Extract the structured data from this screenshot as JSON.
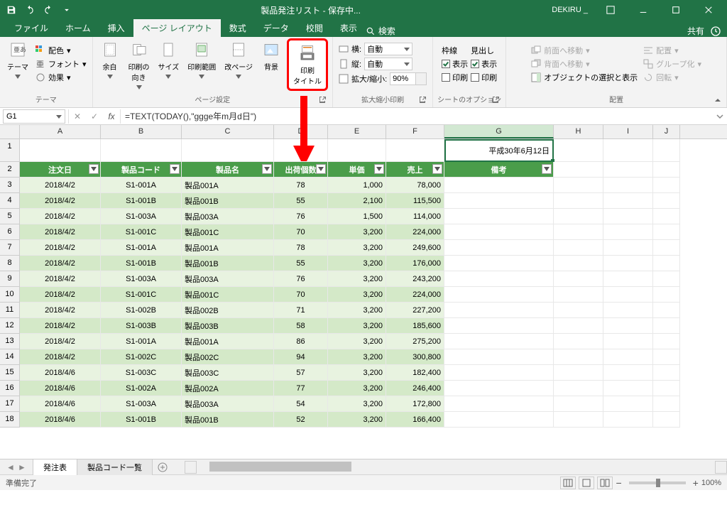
{
  "title": "製品発注リスト - 保存中...",
  "account": "DEKIRU _",
  "file_menu": "ファイル",
  "tabs": [
    "ホーム",
    "挿入",
    "ページ レイアウト",
    "数式",
    "データ",
    "校閲",
    "表示"
  ],
  "search": "検索",
  "share": "共有",
  "ribbon": {
    "themes": {
      "label": "テーマ",
      "theme": "テーマ",
      "colors": "配色",
      "fonts": "フォント",
      "effects": "効果"
    },
    "pagesetup": {
      "label": "ページ設定",
      "margins": "余白",
      "orient": "印刷の\n向き",
      "size": "サイズ",
      "printarea": "印刷範囲",
      "breaks": "改ページ",
      "bg": "背景",
      "titles": "印刷\nタイトル"
    },
    "scale": {
      "label": "拡大縮小印刷",
      "width": "横:",
      "height": "縦:",
      "auto": "自動",
      "scale_lbl": "拡大/縮小:",
      "scale_val": "90%"
    },
    "sheetopt": {
      "label": "シートのオプション",
      "grid": "枠線",
      "head": "見出し",
      "show": "表示",
      "print": "印刷"
    },
    "arrange": {
      "label": "配置",
      "fwd": "前面へ移動",
      "back": "背面へ移動",
      "selpane": "オブジェクトの選択と表示",
      "align": "配置",
      "group": "グループ化",
      "rotate": "回転"
    }
  },
  "namebox": "G1",
  "formula": "=TEXT(TODAY(),\"ggge年m月d日\")",
  "date_cell": "平成30年6月12日",
  "cols": [
    "A",
    "B",
    "C",
    "D",
    "E",
    "F",
    "G",
    "H",
    "I",
    "J"
  ],
  "headers": {
    "a": "注文日",
    "b": "製品コード",
    "c": "製品名",
    "d": "出荷個数",
    "e": "単価",
    "f": "売上",
    "g": "備考"
  },
  "chart_data": {
    "type": "table",
    "columns": [
      "注文日",
      "製品コード",
      "製品名",
      "出荷個数",
      "単価",
      "売上"
    ],
    "rows": [
      [
        "2018/4/2",
        "S1-001A",
        "製品001A",
        78,
        "1,000",
        "78,000"
      ],
      [
        "2018/4/2",
        "S1-001B",
        "製品001B",
        55,
        "2,100",
        "115,500"
      ],
      [
        "2018/4/2",
        "S1-003A",
        "製品003A",
        76,
        "1,500",
        "114,000"
      ],
      [
        "2018/4/2",
        "S1-001C",
        "製品001C",
        70,
        "3,200",
        "224,000"
      ],
      [
        "2018/4/2",
        "S1-001A",
        "製品001A",
        78,
        "3,200",
        "249,600"
      ],
      [
        "2018/4/2",
        "S1-001B",
        "製品001B",
        55,
        "3,200",
        "176,000"
      ],
      [
        "2018/4/2",
        "S1-003A",
        "製品003A",
        76,
        "3,200",
        "243,200"
      ],
      [
        "2018/4/2",
        "S1-001C",
        "製品001C",
        70,
        "3,200",
        "224,000"
      ],
      [
        "2018/4/2",
        "S1-002B",
        "製品002B",
        71,
        "3,200",
        "227,200"
      ],
      [
        "2018/4/2",
        "S1-003B",
        "製品003B",
        58,
        "3,200",
        "185,600"
      ],
      [
        "2018/4/2",
        "S1-001A",
        "製品001A",
        86,
        "3,200",
        "275,200"
      ],
      [
        "2018/4/2",
        "S1-002C",
        "製品002C",
        94,
        "3,200",
        "300,800"
      ],
      [
        "2018/4/6",
        "S1-003C",
        "製品003C",
        57,
        "3,200",
        "182,400"
      ],
      [
        "2018/4/6",
        "S1-002A",
        "製品002A",
        77,
        "3,200",
        "246,400"
      ],
      [
        "2018/4/6",
        "S1-003A",
        "製品003A",
        54,
        "3,200",
        "172,800"
      ],
      [
        "2018/4/6",
        "S1-001B",
        "製品001B",
        52,
        "3,200",
        "166,400"
      ]
    ]
  },
  "sheets": {
    "active": "発注表",
    "other": "製品コード一覧"
  },
  "status": "準備完了",
  "zoom": "100%"
}
